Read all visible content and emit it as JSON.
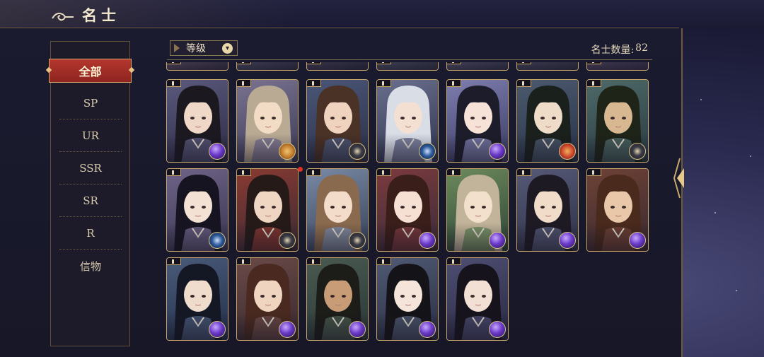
{
  "header": {
    "title": "名士"
  },
  "sidebar": {
    "items": [
      {
        "label": "全部",
        "active": true
      },
      {
        "label": "SP"
      },
      {
        "label": "UR"
      },
      {
        "label": "SSR"
      },
      {
        "label": "SR"
      },
      {
        "label": "R"
      },
      {
        "label": "信物"
      }
    ]
  },
  "toolbar": {
    "sort_label": "等级",
    "count_label": "名士数量:",
    "count_value": "82"
  },
  "colors": {
    "accent_red": "#b3372e",
    "gold": "#c9a86a",
    "cream_text": "#e8dcc0"
  },
  "cards": {
    "partial_row": [
      {
        "palette": [
          "#3a3348",
          "#6a5c72"
        ],
        "badge": "none"
      },
      {
        "palette": [
          "#34344c",
          "#5a5a78"
        ],
        "badge": "none"
      },
      {
        "palette": [
          "#2e3046",
          "#544c66"
        ],
        "badge": "none"
      },
      {
        "palette": [
          "#36384e",
          "#5a5e72"
        ],
        "badge": "none"
      },
      {
        "palette": [
          "#3a3a52",
          "#62607a"
        ],
        "badge": "none"
      },
      {
        "palette": [
          "#34344a",
          "#585670"
        ],
        "badge": "none"
      },
      {
        "palette": [
          "#3a3450",
          "#5e5470"
        ],
        "badge": "none"
      }
    ],
    "rows": [
      [
        {
          "palette": [
            "#2c2a44",
            "#5b5a7e"
          ],
          "hair": "#1b1820",
          "skin": "#f0d8c8",
          "badge": "purple-orb"
        },
        {
          "palette": [
            "#3a3a58",
            "#7a7390"
          ],
          "hair": "#b9aa94",
          "skin": "#f3dcc6",
          "badge": "sun-emblem"
        },
        {
          "palette": [
            "#2a3048",
            "#4b5778"
          ],
          "hair": "#4a3226",
          "skin": "#efd3bf",
          "badge": "eye-emblem"
        },
        {
          "palette": [
            "#2f3450",
            "#6a6f8e"
          ],
          "hair": "#d8dde6",
          "skin": "#f4e0d2",
          "badge": "eye-emblem-blue"
        },
        {
          "palette": [
            "#3a3a62",
            "#7e7fb0"
          ],
          "hair": "#1c1c2a",
          "skin": "#f6e2d6",
          "badge": "purple-orb"
        },
        {
          "palette": [
            "#27324a",
            "#4c5a6e"
          ],
          "hair": "#1a201c",
          "skin": "#eedbc8",
          "badge": "sun-emblem-red"
        },
        {
          "palette": [
            "#2a3a44",
            "#4e6a68"
          ],
          "hair": "#1e2418",
          "skin": "#d8b890",
          "badge": "eye-emblem"
        }
      ],
      [
        {
          "palette": [
            "#3a3450",
            "#6e6488"
          ],
          "hair": "#161420",
          "skin": "#f3e2d4",
          "badge": "eye-emblem-blue"
        },
        {
          "palette": [
            "#3a2a34",
            "#8a3a32"
          ],
          "hair": "#261a18",
          "skin": "#efd6c2",
          "badge": "eye-emblem"
        },
        {
          "palette": [
            "#34405a",
            "#7a8aa4"
          ],
          "hair": "#8a6a4e",
          "skin": "#f4dccb",
          "badge": "eye-emblem"
        },
        {
          "palette": [
            "#3a2c3a",
            "#7c3a3e"
          ],
          "hair": "#3a1e1a",
          "skin": "#f6e0d4",
          "badge": "purple-orb"
        },
        {
          "palette": [
            "#2e4436",
            "#6c8a5c"
          ],
          "hair": "#c2b49a",
          "skin": "#f2e0cc",
          "badge": "purple-orb"
        },
        {
          "palette": [
            "#2e3048",
            "#565a78"
          ],
          "hair": "#1e1a24",
          "skin": "#f0dcc8",
          "badge": "purple-orb"
        },
        {
          "palette": [
            "#3a2a30",
            "#6e4236"
          ],
          "hair": "#4a2a1c",
          "skin": "#e8c8a8",
          "badge": "purple-orb"
        }
      ],
      [
        {
          "palette": [
            "#22304a",
            "#4a5a7a"
          ],
          "hair": "#141824",
          "skin": "#f0dccc",
          "badge": "purple-orb"
        },
        {
          "palette": [
            "#3a2a2e",
            "#6a4a48"
          ],
          "hair": "#4a2a20",
          "skin": "#efd4c0",
          "badge": "purple-orb"
        },
        {
          "palette": [
            "#2a3838",
            "#4a5a50"
          ],
          "hair": "#1c1c18",
          "skin": "#c89c76",
          "badge": "purple-orb"
        },
        {
          "palette": [
            "#2a2e44",
            "#505a74"
          ],
          "hair": "#141418",
          "skin": "#f4e4da",
          "badge": "purple-orb"
        },
        {
          "palette": [
            "#2a2a44",
            "#4e4e72"
          ],
          "hair": "#17131c",
          "skin": "#f2e0d4",
          "badge": "purple-orb"
        }
      ]
    ]
  }
}
